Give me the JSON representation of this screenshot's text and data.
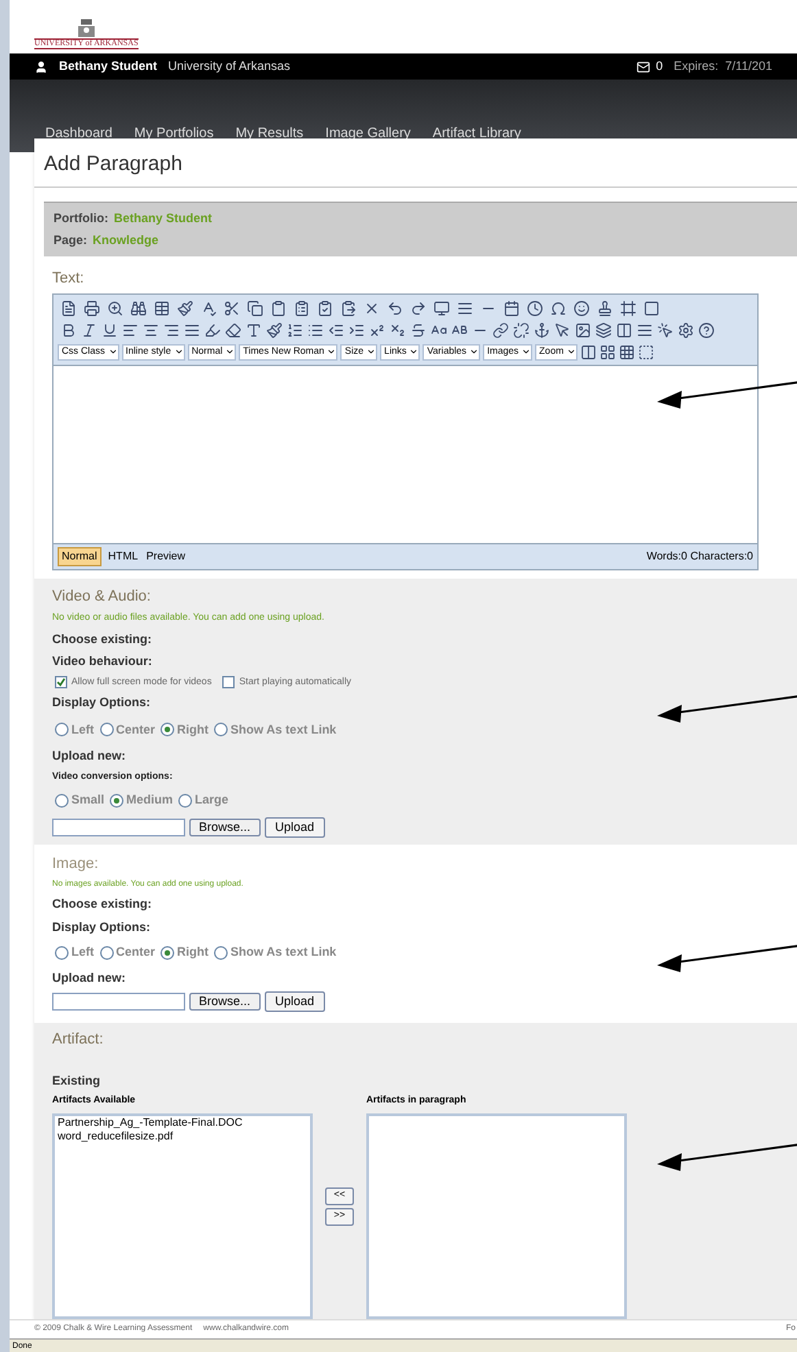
{
  "header": {
    "logo_text": "UNIVERSITY of ARKANSAS",
    "user_name": "Bethany Student",
    "institution": "University of Arkansas",
    "message_count": "0",
    "expires": "Expires:  7/11/201"
  },
  "nav": [
    "Dashboard",
    "My Portfolios",
    "My Results",
    "Image Gallery",
    "Artifact Library"
  ],
  "page_title": "Add Paragraph",
  "info": [
    {
      "label": "Portfolio:",
      "value": "Bethany Student"
    },
    {
      "label": "Page:",
      "value": "Knowledge"
    }
  ],
  "text_section": {
    "title": "Text:",
    "dropdowns": [
      "Css Class",
      "Inline style",
      "Normal",
      "Times New Roman",
      "Size",
      "Links",
      "Variables",
      "Images",
      "Zoom"
    ],
    "modes": [
      {
        "label": "Normal",
        "selected": true
      },
      {
        "label": "HTML",
        "selected": false
      },
      {
        "label": "Preview",
        "selected": false
      }
    ],
    "counter": "Words:0 Characters:0"
  },
  "video_section": {
    "title": "Video & Audio:",
    "notice": "No video or audio files available. You can add one using upload.",
    "choose_existing": "Choose existing:",
    "behaviour_label": "Video behaviour:",
    "behaviour_options": [
      {
        "label": "Allow full screen mode for videos",
        "checked": true
      },
      {
        "label": "Start playing automatically",
        "checked": false
      }
    ],
    "display_label": "Display Options:",
    "display_options": [
      {
        "label": "Left",
        "selected": false
      },
      {
        "label": "Center",
        "selected": false
      },
      {
        "label": "Right",
        "selected": true
      },
      {
        "label": "Show As text Link",
        "selected": false
      }
    ],
    "upload_label": "Upload new:",
    "conversion_label": "Video conversion options:",
    "conversion_options": [
      {
        "label": "Small",
        "selected": false
      },
      {
        "label": "Medium",
        "selected": true
      },
      {
        "label": "Large",
        "selected": false
      }
    ],
    "browse": "Browse...",
    "upload": "Upload"
  },
  "image_section": {
    "title": "Image:",
    "notice": "No images available. You can add one using upload.",
    "choose_existing": "Choose existing:",
    "display_label": "Display Options:",
    "display_options": [
      {
        "label": "Left",
        "selected": false
      },
      {
        "label": "Center",
        "selected": false
      },
      {
        "label": "Right",
        "selected": true
      },
      {
        "label": "Show As text Link",
        "selected": false
      }
    ],
    "upload_label": "Upload new:",
    "browse": "Browse...",
    "upload": "Upload"
  },
  "artifact_section": {
    "title": "Artifact:",
    "existing": "Existing",
    "available_label": "Artifacts Available",
    "available": [
      "Partnership_Ag_-Template-Final.DOC",
      "word_reducefilesize.pdf"
    ],
    "in_paragraph_label": "Artifacts in paragraph",
    "move_left": "<<",
    "move_right": ">>"
  },
  "footer": {
    "copyright": "© 2009 Chalk & Wire Learning Assessment",
    "website": "www.chalkandwire.com",
    "right": "Fo"
  },
  "status_bar": "Done"
}
